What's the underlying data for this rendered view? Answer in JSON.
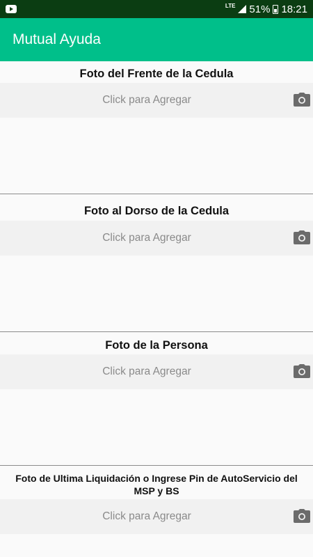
{
  "status_bar": {
    "network": "LTE",
    "battery": "51%",
    "time": "18:21"
  },
  "app_bar": {
    "title": "Mutual Ayuda"
  },
  "sections": [
    {
      "title": "Foto del Frente de la Cedula",
      "add_label": "Click para Agregar",
      "icon": "camera-icon"
    },
    {
      "title": "Foto al Dorso de la Cedula",
      "add_label": "Click para Agregar",
      "icon": "camera-icon"
    },
    {
      "title": "Foto de la Persona",
      "add_label": "Click para Agregar",
      "icon": "camera-icon"
    },
    {
      "title": "Foto de Ultima Liquidación o Ingrese Pin de AutoServicio del MSP y BS",
      "add_label": "Click para Agregar",
      "icon": "camera-icon"
    }
  ],
  "colors": {
    "status_bar": "#0b3d12",
    "app_bar": "#00bf8a",
    "add_row": "#f1f1f1",
    "icon": "#6b6b6b"
  }
}
